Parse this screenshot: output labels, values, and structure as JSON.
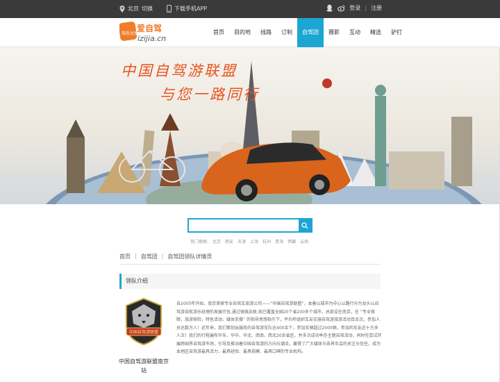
{
  "topbar": {
    "city": "北京",
    "switch_label": "切换",
    "app_label": "下载手机APP",
    "login": "登录",
    "divider": "|",
    "register": "注册"
  },
  "header": {
    "logo_text": "爱自驾",
    "logo_sub": "izijia.cn",
    "logo_tag": "驾乐分享",
    "nav": [
      {
        "label": "首页"
      },
      {
        "label": "目的地"
      },
      {
        "label": "线路"
      },
      {
        "label": "订制"
      },
      {
        "label": "自驾团"
      },
      {
        "label": "摄影"
      },
      {
        "label": "互动"
      },
      {
        "label": "精选"
      },
      {
        "label": "驴打"
      }
    ]
  },
  "banner": {
    "line1": "中国自驾游联盟",
    "line2": "与您一路同行"
  },
  "search": {
    "placeholder": "",
    "hot_label": "热门搜索:",
    "hot_terms": [
      "北京",
      "西安",
      "天津",
      "上海",
      "杭州",
      "青海",
      "西藏",
      "云南"
    ]
  },
  "breadcrumb": {
    "items": [
      "首页",
      "自驾团",
      "自驾团领队详情页"
    ],
    "sep": "|"
  },
  "section": {
    "title": "领队介绍",
    "badge_text": "中国自驾游联盟",
    "leader_name": "中国自驾游联盟南京站",
    "intro": "自2005年开始，南京首家专业自驾车旅游公司——“中国自驾游联盟”，本着以城市为中心以路行分为龙头以自驾游自航游乐经理的发展宗旨,通过强强友联,现已覆盖全国20个省200多个城市，总部设在南京，在 “专业保障，旅游探险，特色活动，媒体支撑” 的指导思想指引下，平均年组织车友实施自驾游旅游活动百余次，参加人员达数万人！近年来，我们策划出服务的自驾游车队达400余个，参加车辆超过2000辆，参加的车友近十万多人次！我们的行程遍布华东、华中、华北、西南、西北20余省区，并多次成功举办主题自驾活动，同时在尝试开展跨国界自驾游市场，引导及推动着中国自驾游的方向与潮流，赢得了广大媒体与各界车会的关注与信任，成为本地区自驾游最具活力、最具经验、最具规模、最具口碑的专业机构。"
  },
  "colors": {
    "accent": "#1ca6d3",
    "topbar": "#3a3a3a",
    "slogan": "#e8521e",
    "logo": "#f07d2a"
  }
}
